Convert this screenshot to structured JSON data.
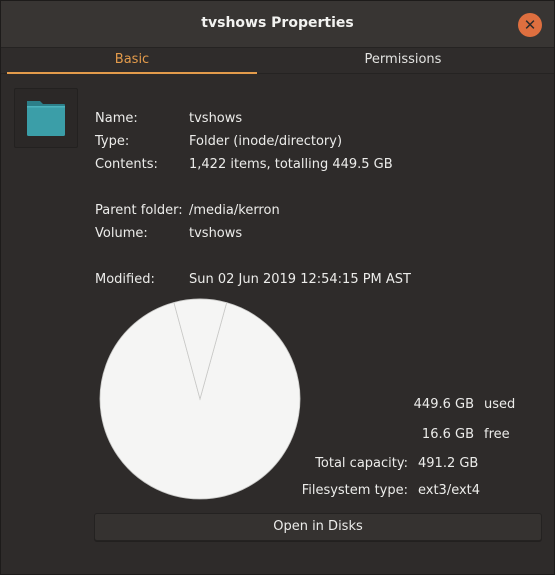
{
  "window": {
    "title": "tvshows Properties",
    "close_glyph": "✕"
  },
  "tabs": [
    {
      "label": "Basic"
    },
    {
      "label": "Permissions"
    }
  ],
  "info": {
    "name_label": "Name:",
    "name_value": "tvshows",
    "type_label": "Type:",
    "type_value": "Folder (inode/directory)",
    "contents_label": "Contents:",
    "contents_value": "1,422 items, totalling 449.5 GB",
    "parent_label": "Parent folder:",
    "parent_value": "/media/kerron",
    "volume_label": "Volume:",
    "volume_value": "tvshows",
    "modified_label": "Modified:",
    "modified_value": "Sun 02 Jun 2019 12:54:15 PM AST"
  },
  "usage": {
    "used_value": "449.6 GB",
    "used_label": "used",
    "free_value": "16.6 GB",
    "free_label": "free",
    "capacity_label": "Total capacity:",
    "capacity_value": "491.2 GB",
    "fstype_label": "Filesystem type:",
    "fstype_value": "ext3/ext4",
    "used_fraction": 0.915
  },
  "actions": {
    "open_disks": "Open in Disks"
  },
  "icons": {
    "folder": "folder-icon",
    "close": "close-icon"
  },
  "colors": {
    "accent": "#e39b4b",
    "close_button": "#de6f3f",
    "folder": "#3b9ea8",
    "pie_fill": "#f5f5f4"
  }
}
